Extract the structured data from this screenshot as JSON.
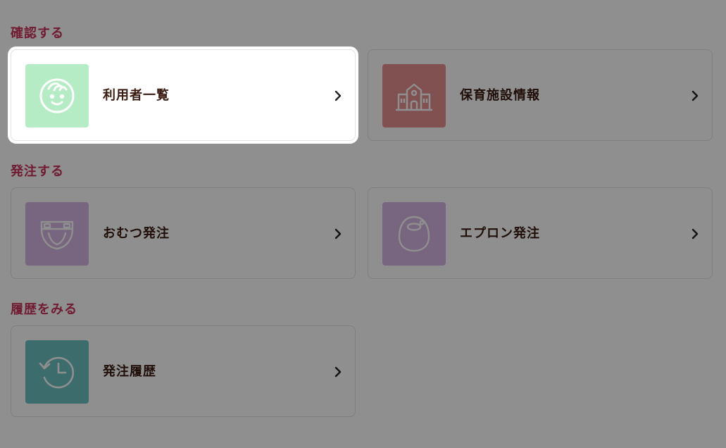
{
  "sections": [
    {
      "title": "確認する"
    },
    {
      "title": "発注する"
    },
    {
      "title": "履歴をみる"
    }
  ],
  "cards": {
    "users": {
      "label": "利用者一覧",
      "icon": "child-face-icon",
      "color": "#b5ecc5"
    },
    "facility": {
      "label": "保育施設情報",
      "icon": "school-building-icon",
      "color": "#e79090"
    },
    "diaper": {
      "label": "おむつ発注",
      "icon": "diaper-icon",
      "color": "#d7b4e2"
    },
    "apron": {
      "label": "エプロン発注",
      "icon": "bib-icon",
      "color": "#d7b4e2"
    },
    "history": {
      "label": "発注履歴",
      "icon": "history-clock-icon",
      "color": "#6ec1c3"
    }
  },
  "colors": {
    "accent": "#c8325a",
    "label": "#3a1a10",
    "overlay": "rgba(0,0,0,0.44)"
  }
}
